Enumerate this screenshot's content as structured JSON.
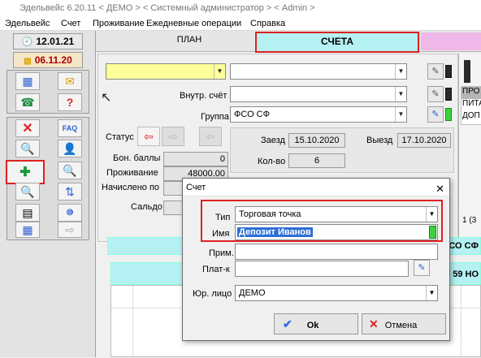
{
  "window": {
    "title": "Эдельвейс 6.20.11 < ДЕМО > < Системный администратор > < Admin >"
  },
  "menu": [
    "Эдельвейс",
    "Счет",
    "Проживание",
    "Ежедневные операции",
    "Справка"
  ],
  "left": {
    "date1": "12.01.21",
    "date2": "06.11.20"
  },
  "tabs": {
    "plan": "ПЛАН",
    "scheta": "СЧЕТА"
  },
  "form": {
    "internal_account_label": "Внутр. счёт",
    "group_label": "Группа",
    "group_value": "ФСО СФ",
    "status_label": "Статус",
    "bonus_label": "Бон. баллы",
    "bonus_value": "0",
    "stay_label": "Проживание",
    "stay_value": "48000.00",
    "charged_label": "Начислено по",
    "balance_label": "Сальдо",
    "checkin_label": "Заезд",
    "checkin_value": "15.10.2020",
    "checkout_label": "Выезд",
    "checkout_value": "17.10.2020",
    "count_label": "Кол-во",
    "count_value": "6"
  },
  "right_panel": {
    "items": [
      "ПРО",
      "ПИТА",
      "ДОП"
    ],
    "counter": "1 (3",
    "fso_tag": "ФСО СФ",
    "number_tag": "59 НО"
  },
  "dialog": {
    "title": "Счет",
    "close": "✕",
    "type_label": "Тип",
    "type_value": "Торговая точка",
    "name_label": "Имя",
    "name_value": "Депозит Иванов",
    "note_label": "Прим.",
    "payer_label": "Плат-к",
    "legal_label": "Юр. лицо",
    "legal_value": "ДЕМО",
    "ok_label": "Ok",
    "cancel_label": "Отмена"
  },
  "colors": {
    "accent_cyan": "#b5f1f3",
    "highlight_red": "#dd2222",
    "field_yellow": "#ffff99",
    "selection_blue": "#2f6fd6"
  },
  "icons": [
    "clock-icon",
    "calendar-icon",
    "contacts-icon",
    "mail-icon",
    "phone-icon",
    "help-icon",
    "delete-icon",
    "faq-icon",
    "search-icon",
    "user-search-icon",
    "add-icon",
    "document-search-icon",
    "transfer-icon",
    "print-icon",
    "calculator-icon",
    "keypad-icon",
    "export-icon",
    "edit-icon",
    "pencil-icon",
    "check-icon",
    "cross-icon"
  ]
}
